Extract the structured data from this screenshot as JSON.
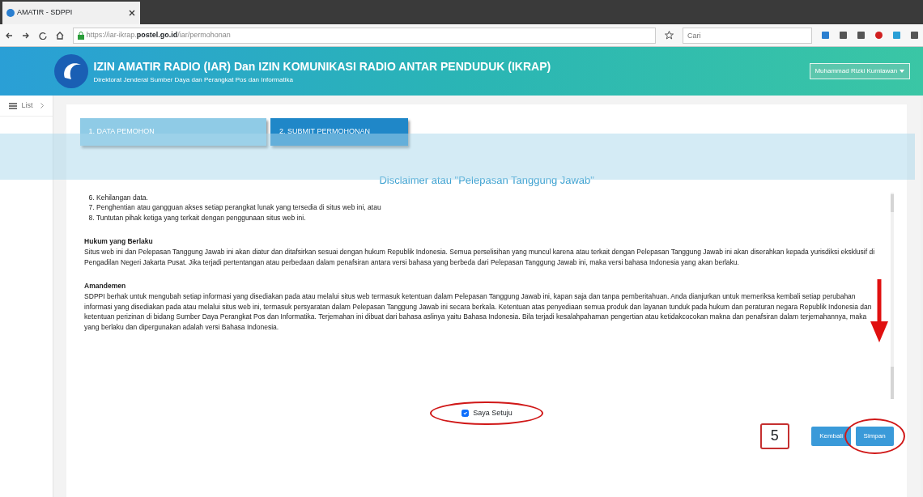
{
  "browser": {
    "tab_title": "AMATIR - SDPPI",
    "url_prefix": "https://iar-ikrap.",
    "url_domain": "postel.go.id",
    "url_path": "/iar/permohonan",
    "search_placeholder": "Cari"
  },
  "header": {
    "title": "IZIN AMATIR RADIO (IAR) Dan IZIN KOMUNIKASI RADIO ANTAR PENDUDUK (IKRAP)",
    "subtitle": "Direktorat Jenderal Sumber Daya dan Perangkat Pos dan Informatika",
    "user": "Muhammad Rizki Kurniawan"
  },
  "sidebar": {
    "items": [
      {
        "label": "List",
        "selected": false
      }
    ]
  },
  "steps": [
    {
      "label": "1. DATA PEMOHON",
      "selected": false
    },
    {
      "label": "2. SUBMIT PERMOHONAN",
      "selected": true
    }
  ],
  "disclaimer": {
    "title": "Disclaimer atau \"Pelepasan Tanggung Jawab\"",
    "list_items": [
      "6. Kehilangan data.",
      "7. Penghentian atau gangguan akses setiap perangkat lunak yang tersedia di situs web ini, atau",
      "8. Tuntutan pihak ketiga yang terkait dengan penggunaan situs web ini."
    ],
    "sections": [
      {
        "heading": "Hukum yang Berlaku",
        "body": "Situs web ini dan Pelepasan Tanggung Jawab ini akan diatur dan ditafsirkan sesuai dengan hukum Republik Indonesia. Semua perselisihan yang muncul karena atau terkait dengan Pelepasan Tanggung Jawab ini akan diserahkan kepada yurisdiksi eksklusif di Pengadilan Negeri Jakarta Pusat. Jika terjadi pertentangan atau perbedaan dalam penafsiran antara versi bahasa yang berbeda dari Pelepasan Tanggung Jawab ini, maka versi bahasa Indonesia yang akan berlaku."
      },
      {
        "heading": "Amandemen",
        "body": "SDPPI berhak untuk mengubah setiap informasi yang disediakan pada atau melalui situs web termasuk ketentuan dalam Pelepasan Tanggung Jawab ini, kapan saja dan tanpa pemberitahuan. Anda dianjurkan untuk memeriksa kembali setiap perubahan informasi yang disediakan pada atau melalui situs web ini, termasuk persyaratan dalam Pelepasan Tanggung Jawab ini secara berkala. Ketentuan atas penyediaan semua produk dan layanan tunduk pada hukum dan peraturan negara Republik Indonesia dan ketentuan perizinan di bidang Sumber Daya Perangkat Pos dan Informatika. Terjemahan ini dibuat dari bahasa aslinya yaitu Bahasa Indonesia. Bila terjadi kesalahpahaman pengertian atau ketidakcocokan makna dan penafsiran dalam terjemahannya, maka yang berlaku dan dipergunakan adalah versi Bahasa Indonesia."
      }
    ],
    "agree": {
      "label": "Saya Setuju",
      "checked": true
    }
  },
  "buttons": [
    "Kembali",
    "Simpan"
  ],
  "annotation": {
    "step_number": "5"
  }
}
